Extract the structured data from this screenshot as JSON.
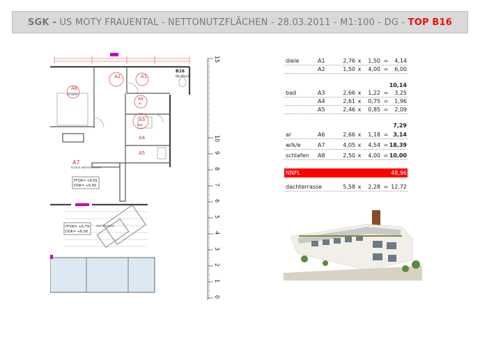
{
  "header": {
    "prefix": "SGK -",
    "middle": " US MOTY FRAUENTAL - NETTONUTZFLÄCHEN - 28.03.2011 - M1:100 - DG - ",
    "unit": "TOP B16"
  },
  "plan": {
    "unit_label": "B16",
    "unit_area": "68,96m2",
    "rooms": [
      {
        "code": "A1",
        "name": ""
      },
      {
        "code": "A2",
        "name": ""
      },
      {
        "code": "A3",
        "name": "bad"
      },
      {
        "code": "A4",
        "name": "ar"
      },
      {
        "code": "A5",
        "name": ""
      },
      {
        "code": "A7",
        "name": "küche/ wohnen/essen"
      },
      {
        "code": "A8",
        "name": "schlafen"
      }
    ],
    "level_1_a": "FFOK= +6,81",
    "level_1_b": "DOK= +6,56",
    "level_2_a": "FFOK= +6,79",
    "level_2_b": "DOK= +6,56",
    "terrace_label": "dachterrasse"
  },
  "ruler": {
    "ticks": [
      "15",
      "10",
      "9",
      "8",
      "7",
      "6",
      "5",
      "4",
      "3",
      "2",
      "1",
      "0"
    ]
  },
  "table": {
    "rows": [
      {
        "name": "diele",
        "code": "A1",
        "w": "2,76",
        "x": "x",
        "h": "1,50",
        "eq": "=",
        "v": "4,14"
      },
      {
        "name": "",
        "code": "A2",
        "w": "1,50",
        "x": "x",
        "h": "4,00",
        "eq": "=",
        "v": "6,00"
      },
      {
        "sum": "10,14"
      },
      {
        "name": "bad",
        "code": "A3",
        "w": "2,66",
        "x": "x",
        "h": "1,22",
        "eq": "=",
        "v": "3,25"
      },
      {
        "name": "",
        "code": "A4",
        "w": "2,61",
        "x": "x",
        "h": "0,75",
        "eq": "=",
        "v": "1,96"
      },
      {
        "name": "",
        "code": "A5",
        "w": "2,46",
        "x": "x",
        "h": "0,85",
        "eq": "=",
        "v": "2,09"
      },
      {
        "sum": "7,29"
      },
      {
        "name": "ar",
        "code": "A6",
        "w": "2,66",
        "x": "x",
        "h": "1,18",
        "eq": "=",
        "v": "3,14"
      },
      {
        "name": "w/k/e",
        "code": "A7",
        "w": "4,05",
        "x": "x",
        "h": "4,54",
        "eq": "=",
        "v": "18,39"
      },
      {
        "name": "schlafen",
        "code": "A8",
        "w": "2,50",
        "x": "x",
        "h": "4,00",
        "eq": "=",
        "v": "10,00"
      }
    ],
    "nnfl_label": "NNFL",
    "nnfl_value": "48,96",
    "terrace": {
      "name": "dachterrasse",
      "w": "5,58",
      "x": "x",
      "h": "2,28",
      "eq": "=",
      "v": "12,72"
    }
  },
  "colors": {
    "accent_red": "#ff0000",
    "header_bg": "#d9d9d9",
    "plan_magenta": "#c800c8",
    "plan_red": "#e04040"
  }
}
